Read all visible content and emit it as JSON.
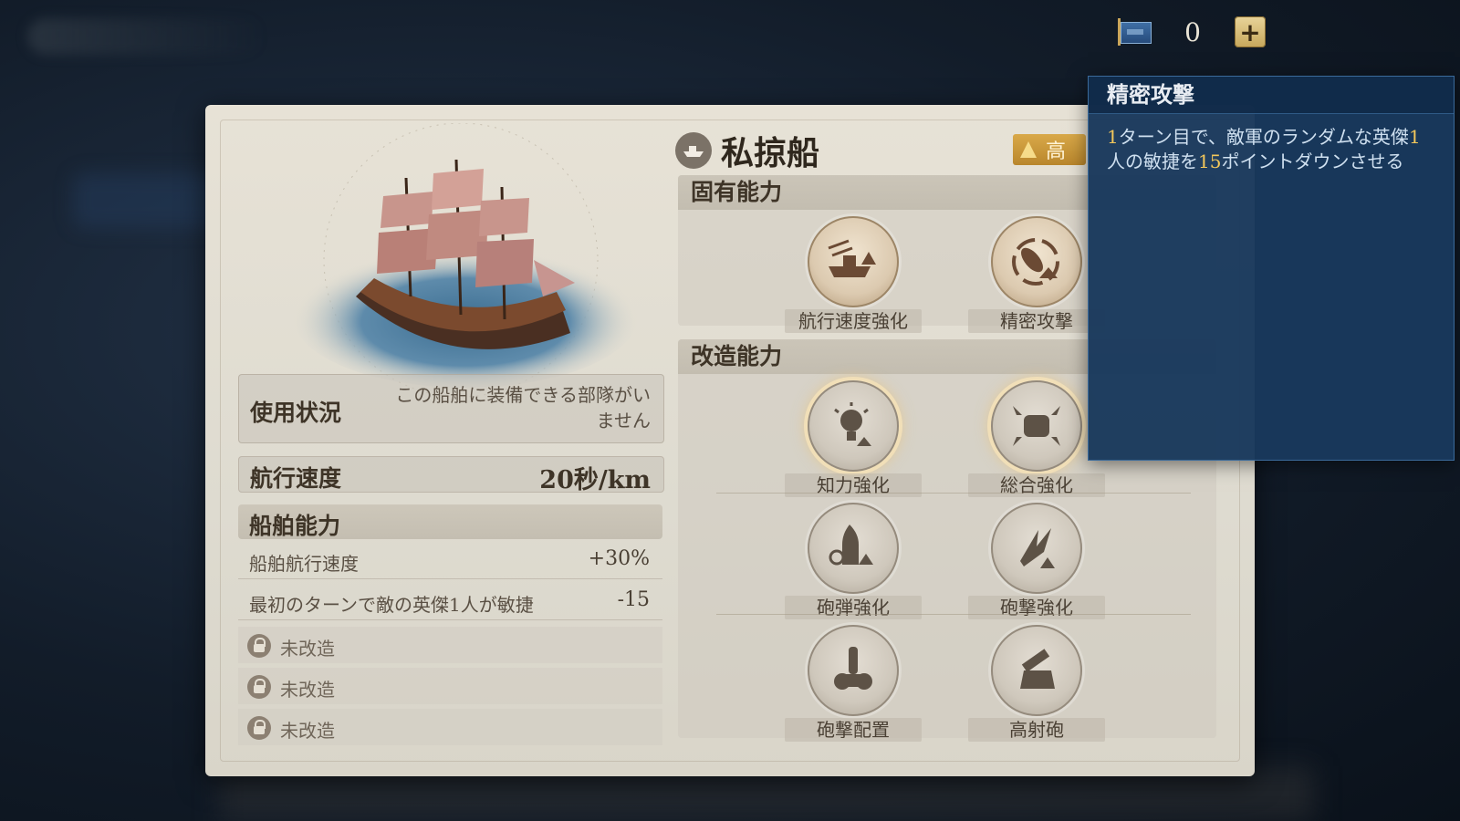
{
  "topbar": {
    "flag_icon": "blue-flag-icon",
    "count": "0",
    "plus_label": "+"
  },
  "ship": {
    "type_icon": "ship-icon",
    "name": "私掠船",
    "rank": "高"
  },
  "info": {
    "usage_label": "使用状況",
    "usage_value": "この船舶に装備できる部隊がいません",
    "speed_label": "航行速度",
    "speed_value": "20秒/km",
    "ability_title": "船舶能力",
    "stats": [
      {
        "label": "船舶航行速度",
        "value": "+30%"
      },
      {
        "label": "最初のターンで敵の英傑1人が敏捷",
        "value": "-15"
      }
    ],
    "locked": [
      {
        "label": "未改造",
        "icon": "lock-icon"
      },
      {
        "label": "未改造",
        "icon": "lock-icon"
      },
      {
        "label": "未改造",
        "icon": "lock-icon"
      }
    ]
  },
  "inherent": {
    "title": "固有能力",
    "skills": [
      {
        "name": "航行速度強化",
        "icon": "ship-speed-icon"
      },
      {
        "name": "精密攻撃",
        "icon": "precision-attack-icon"
      }
    ]
  },
  "modify": {
    "title": "改造能力",
    "skills": [
      {
        "name": "知力強化",
        "icon": "lightbulb-icon"
      },
      {
        "name": "総合強化",
        "icon": "fist-icon"
      },
      {
        "name": "砲弾強化",
        "icon": "shell-icon"
      },
      {
        "name": "砲撃強化",
        "icon": "explosion-icon"
      },
      {
        "name": "砲撃配置",
        "icon": "cannon-icon"
      },
      {
        "name": "高射砲",
        "icon": "anti-air-gun-icon"
      }
    ]
  },
  "tooltip": {
    "title": "精密攻撃",
    "parts": [
      "1",
      "ターン目で、敵軍のランダムな英傑",
      "1",
      "人の敏捷を",
      "15",
      "ポイントダウンさせる"
    ]
  }
}
